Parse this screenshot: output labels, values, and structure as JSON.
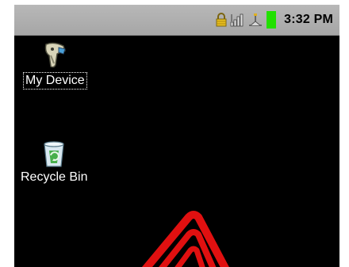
{
  "statusbar": {
    "time": "3:32 PM",
    "icons": [
      "lock-icon",
      "signal-icon",
      "network-icon",
      "battery-icon"
    ],
    "battery_color": "#22e000",
    "lock_color": "#e8c020"
  },
  "desktop": {
    "background": "#000000",
    "icons": [
      {
        "label": "My Device",
        "icon": "scanner-device-icon",
        "selected": true
      },
      {
        "label": "Recycle Bin",
        "icon": "recycle-bin-icon",
        "selected": false
      }
    ]
  },
  "wallpaper": {
    "logo_icon": "brand-logo-icon",
    "logo_color": "#e01010"
  }
}
